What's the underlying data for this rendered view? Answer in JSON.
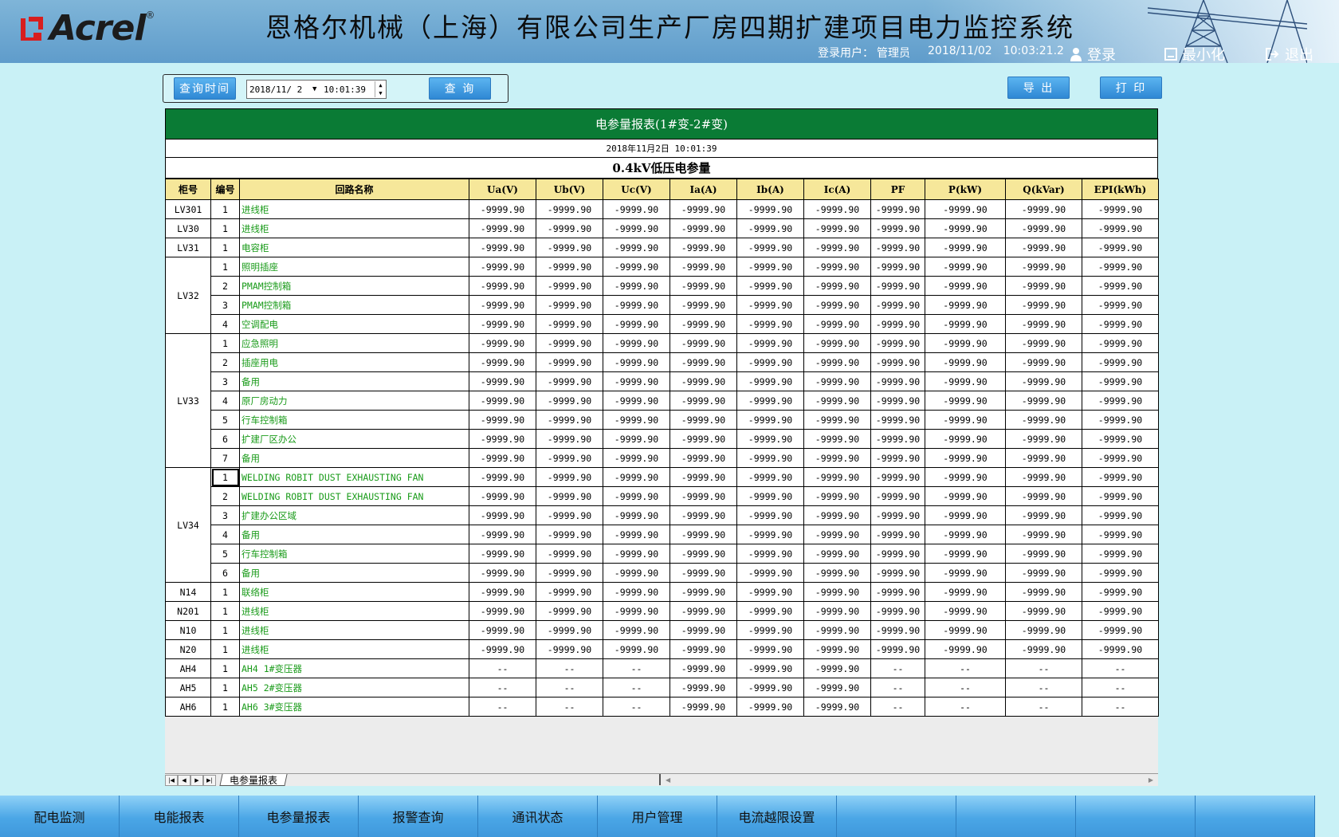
{
  "header": {
    "logo_text": "Acrel",
    "logo_reg": "®",
    "title": "恩格尔机械（上海）有限公司生产厂房四期扩建项目电力监控系统",
    "user_label": "登录用户：",
    "user_name": "管理员",
    "date": "2018/11/02",
    "time": "10:03:21.2",
    "login": "登录",
    "minimize": "最小化",
    "exit": "退出"
  },
  "query": {
    "label": "查询时间",
    "date": "2018/11/ 2",
    "time": "10:01:39",
    "query_btn": "查 询",
    "export_btn": "导 出",
    "print_btn": "打 印"
  },
  "report": {
    "title": "电参量报表(1#变-2#变)",
    "datetime": "2018年11月2日 10:01:39",
    "subtitle": "0.4kV低压电参量",
    "columns": [
      "柜号",
      "编号",
      "回路名称",
      "Ua(V)",
      "Ub(V)",
      "Uc(V)",
      "Ia(A)",
      "Ib(A)",
      "Ic(A)",
      "PF",
      "P(kW)",
      "Q(kVar)",
      "EPI(kWh)"
    ],
    "groups": [
      {
        "cabinet": "LV301",
        "rows": [
          {
            "no": "1",
            "name": "进线柜",
            "vals": [
              "-9999.90",
              "-9999.90",
              "-9999.90",
              "-9999.90",
              "-9999.90",
              "-9999.90",
              "-9999.90",
              "-9999.90",
              "-9999.90",
              "-9999.90"
            ]
          }
        ]
      },
      {
        "cabinet": "LV30",
        "rows": [
          {
            "no": "1",
            "name": "进线柜",
            "vals": [
              "-9999.90",
              "-9999.90",
              "-9999.90",
              "-9999.90",
              "-9999.90",
              "-9999.90",
              "-9999.90",
              "-9999.90",
              "-9999.90",
              "-9999.90"
            ]
          }
        ]
      },
      {
        "cabinet": "LV31",
        "rows": [
          {
            "no": "1",
            "name": "电容柜",
            "vals": [
              "-9999.90",
              "-9999.90",
              "-9999.90",
              "-9999.90",
              "-9999.90",
              "-9999.90",
              "-9999.90",
              "-9999.90",
              "-9999.90",
              "-9999.90"
            ]
          }
        ]
      },
      {
        "cabinet": "LV32",
        "rows": [
          {
            "no": "1",
            "name": "照明插座",
            "vals": [
              "-9999.90",
              "-9999.90",
              "-9999.90",
              "-9999.90",
              "-9999.90",
              "-9999.90",
              "-9999.90",
              "-9999.90",
              "-9999.90",
              "-9999.90"
            ]
          },
          {
            "no": "2",
            "name": "PMAM控制箱",
            "vals": [
              "-9999.90",
              "-9999.90",
              "-9999.90",
              "-9999.90",
              "-9999.90",
              "-9999.90",
              "-9999.90",
              "-9999.90",
              "-9999.90",
              "-9999.90"
            ]
          },
          {
            "no": "3",
            "name": "PMAM控制箱",
            "vals": [
              "-9999.90",
              "-9999.90",
              "-9999.90",
              "-9999.90",
              "-9999.90",
              "-9999.90",
              "-9999.90",
              "-9999.90",
              "-9999.90",
              "-9999.90"
            ]
          },
          {
            "no": "4",
            "name": "空调配电",
            "vals": [
              "-9999.90",
              "-9999.90",
              "-9999.90",
              "-9999.90",
              "-9999.90",
              "-9999.90",
              "-9999.90",
              "-9999.90",
              "-9999.90",
              "-9999.90"
            ]
          }
        ]
      },
      {
        "cabinet": "LV33",
        "rows": [
          {
            "no": "1",
            "name": "应急照明",
            "vals": [
              "-9999.90",
              "-9999.90",
              "-9999.90",
              "-9999.90",
              "-9999.90",
              "-9999.90",
              "-9999.90",
              "-9999.90",
              "-9999.90",
              "-9999.90"
            ]
          },
          {
            "no": "2",
            "name": "插座用电",
            "vals": [
              "-9999.90",
              "-9999.90",
              "-9999.90",
              "-9999.90",
              "-9999.90",
              "-9999.90",
              "-9999.90",
              "-9999.90",
              "-9999.90",
              "-9999.90"
            ]
          },
          {
            "no": "3",
            "name": "备用",
            "vals": [
              "-9999.90",
              "-9999.90",
              "-9999.90",
              "-9999.90",
              "-9999.90",
              "-9999.90",
              "-9999.90",
              "-9999.90",
              "-9999.90",
              "-9999.90"
            ]
          },
          {
            "no": "4",
            "name": "原厂房动力",
            "vals": [
              "-9999.90",
              "-9999.90",
              "-9999.90",
              "-9999.90",
              "-9999.90",
              "-9999.90",
              "-9999.90",
              "-9999.90",
              "-9999.90",
              "-9999.90"
            ]
          },
          {
            "no": "5",
            "name": "行车控制箱",
            "vals": [
              "-9999.90",
              "-9999.90",
              "-9999.90",
              "-9999.90",
              "-9999.90",
              "-9999.90",
              "-9999.90",
              "-9999.90",
              "-9999.90",
              "-9999.90"
            ]
          },
          {
            "no": "6",
            "name": "扩建厂区办公",
            "vals": [
              "-9999.90",
              "-9999.90",
              "-9999.90",
              "-9999.90",
              "-9999.90",
              "-9999.90",
              "-9999.90",
              "-9999.90",
              "-9999.90",
              "-9999.90"
            ]
          },
          {
            "no": "7",
            "name": "备用",
            "vals": [
              "-9999.90",
              "-9999.90",
              "-9999.90",
              "-9999.90",
              "-9999.90",
              "-9999.90",
              "-9999.90",
              "-9999.90",
              "-9999.90",
              "-9999.90"
            ]
          }
        ]
      },
      {
        "cabinet": "LV34",
        "rows": [
          {
            "no": "1",
            "name": "WELDING ROBIT DUST EXHAUSTING FAN",
            "vals": [
              "-9999.90",
              "-9999.90",
              "-9999.90",
              "-9999.90",
              "-9999.90",
              "-9999.90",
              "-9999.90",
              "-9999.90",
              "-9999.90",
              "-9999.90"
            ]
          },
          {
            "no": "2",
            "name": "WELDING ROBIT DUST EXHAUSTING FAN",
            "vals": [
              "-9999.90",
              "-9999.90",
              "-9999.90",
              "-9999.90",
              "-9999.90",
              "-9999.90",
              "-9999.90",
              "-9999.90",
              "-9999.90",
              "-9999.90"
            ]
          },
          {
            "no": "3",
            "name": "扩建办公区域",
            "vals": [
              "-9999.90",
              "-9999.90",
              "-9999.90",
              "-9999.90",
              "-9999.90",
              "-9999.90",
              "-9999.90",
              "-9999.90",
              "-9999.90",
              "-9999.90"
            ]
          },
          {
            "no": "4",
            "name": "备用",
            "vals": [
              "-9999.90",
              "-9999.90",
              "-9999.90",
              "-9999.90",
              "-9999.90",
              "-9999.90",
              "-9999.90",
              "-9999.90",
              "-9999.90",
              "-9999.90"
            ]
          },
          {
            "no": "5",
            "name": "行车控制箱",
            "vals": [
              "-9999.90",
              "-9999.90",
              "-9999.90",
              "-9999.90",
              "-9999.90",
              "-9999.90",
              "-9999.90",
              "-9999.90",
              "-9999.90",
              "-9999.90"
            ]
          },
          {
            "no": "6",
            "name": "备用",
            "vals": [
              "-9999.90",
              "-9999.90",
              "-9999.90",
              "-9999.90",
              "-9999.90",
              "-9999.90",
              "-9999.90",
              "-9999.90",
              "-9999.90",
              "-9999.90"
            ]
          }
        ]
      },
      {
        "cabinet": "N14",
        "rows": [
          {
            "no": "1",
            "name": "联络柜",
            "vals": [
              "-9999.90",
              "-9999.90",
              "-9999.90",
              "-9999.90",
              "-9999.90",
              "-9999.90",
              "-9999.90",
              "-9999.90",
              "-9999.90",
              "-9999.90"
            ]
          }
        ]
      },
      {
        "cabinet": "N201",
        "rows": [
          {
            "no": "1",
            "name": "进线柜",
            "vals": [
              "-9999.90",
              "-9999.90",
              "-9999.90",
              "-9999.90",
              "-9999.90",
              "-9999.90",
              "-9999.90",
              "-9999.90",
              "-9999.90",
              "-9999.90"
            ]
          }
        ]
      },
      {
        "cabinet": "N10",
        "rows": [
          {
            "no": "1",
            "name": "进线柜",
            "vals": [
              "-9999.90",
              "-9999.90",
              "-9999.90",
              "-9999.90",
              "-9999.90",
              "-9999.90",
              "-9999.90",
              "-9999.90",
              "-9999.90",
              "-9999.90"
            ]
          }
        ]
      },
      {
        "cabinet": "N20",
        "rows": [
          {
            "no": "1",
            "name": "进线柜",
            "vals": [
              "-9999.90",
              "-9999.90",
              "-9999.90",
              "-9999.90",
              "-9999.90",
              "-9999.90",
              "-9999.90",
              "-9999.90",
              "-9999.90",
              "-9999.90"
            ]
          }
        ]
      },
      {
        "cabinet": "AH4",
        "rows": [
          {
            "no": "1",
            "name": "AH4 1#变压器",
            "vals": [
              "--",
              "--",
              "--",
              "-9999.90",
              "-9999.90",
              "-9999.90",
              "--",
              "--",
              "--",
              "--"
            ]
          }
        ]
      },
      {
        "cabinet": "AH5",
        "rows": [
          {
            "no": "1",
            "name": "AH5 2#变压器",
            "vals": [
              "--",
              "--",
              "--",
              "-9999.90",
              "-9999.90",
              "-9999.90",
              "--",
              "--",
              "--",
              "--"
            ]
          }
        ]
      },
      {
        "cabinet": "AH6",
        "rows": [
          {
            "no": "1",
            "name": "AH6 3#变压器",
            "vals": [
              "--",
              "--",
              "--",
              "-9999.90",
              "-9999.90",
              "-9999.90",
              "--",
              "--",
              "--",
              "--"
            ]
          }
        ]
      }
    ]
  },
  "sheet": {
    "tab": "电参量报表"
  },
  "nav": {
    "items": [
      "配电监测",
      "电能报表",
      "电参量报表",
      "报警查询",
      "通讯状态",
      "用户管理",
      "电流越限设置",
      "",
      "",
      "",
      ""
    ]
  },
  "colors": {
    "title_green": "#0a7b35",
    "header_yellow": "#f6e79a",
    "name_green": "#1a9b1a",
    "page_bg": "#c9f1f6"
  }
}
